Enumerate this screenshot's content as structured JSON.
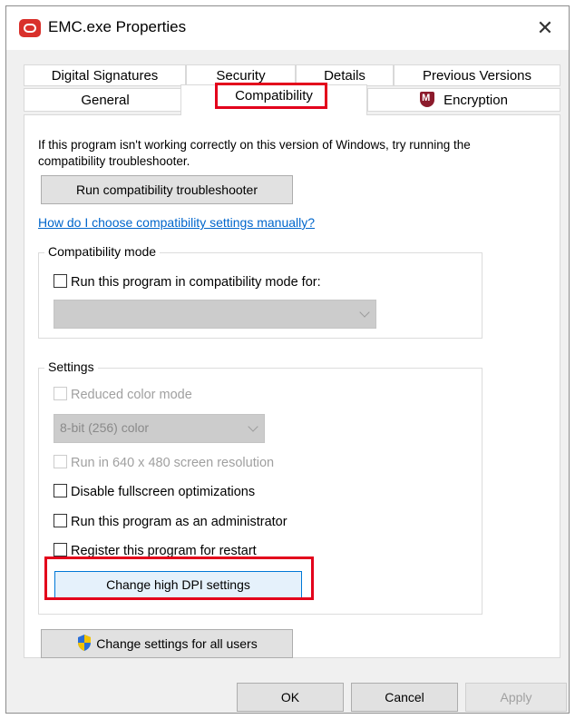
{
  "window": {
    "title": "EMC.exe Properties",
    "close_label": "✕"
  },
  "tabs": {
    "row1": [
      {
        "label": "Digital Signatures"
      },
      {
        "label": "Security"
      },
      {
        "label": "Details"
      },
      {
        "label": "Previous Versions"
      }
    ],
    "row2": [
      {
        "label": "General"
      },
      {
        "label": "Compatibility",
        "active": true
      },
      {
        "label": "Encryption"
      }
    ]
  },
  "compatibility": {
    "intro": "If this program isn't working correctly on this version of Windows, try running the compatibility troubleshooter.",
    "troubleshooter_button": "Run compatibility troubleshooter",
    "help_link": "How do I choose compatibility settings manually?",
    "mode_group": {
      "label": "Compatibility mode",
      "checkbox": "Run this program in compatibility mode for:",
      "select_value": ""
    },
    "settings_group": {
      "label": "Settings",
      "reduced_color": "Reduced color mode",
      "color_select": "8-bit (256) color",
      "resolution": "Run in 640 x 480 screen resolution",
      "disable_fullscreen": "Disable fullscreen optimizations",
      "run_as_admin": "Run this program as an administrator",
      "register_restart": "Register this program for restart",
      "dpi_button": "Change high DPI settings"
    },
    "all_users_button": "Change settings for all users"
  },
  "footer": {
    "ok": "OK",
    "cancel": "Cancel",
    "apply": "Apply"
  },
  "colors": {
    "highlight": "#e3001b",
    "link": "#0066cc",
    "accent_border": "#0078d7"
  }
}
